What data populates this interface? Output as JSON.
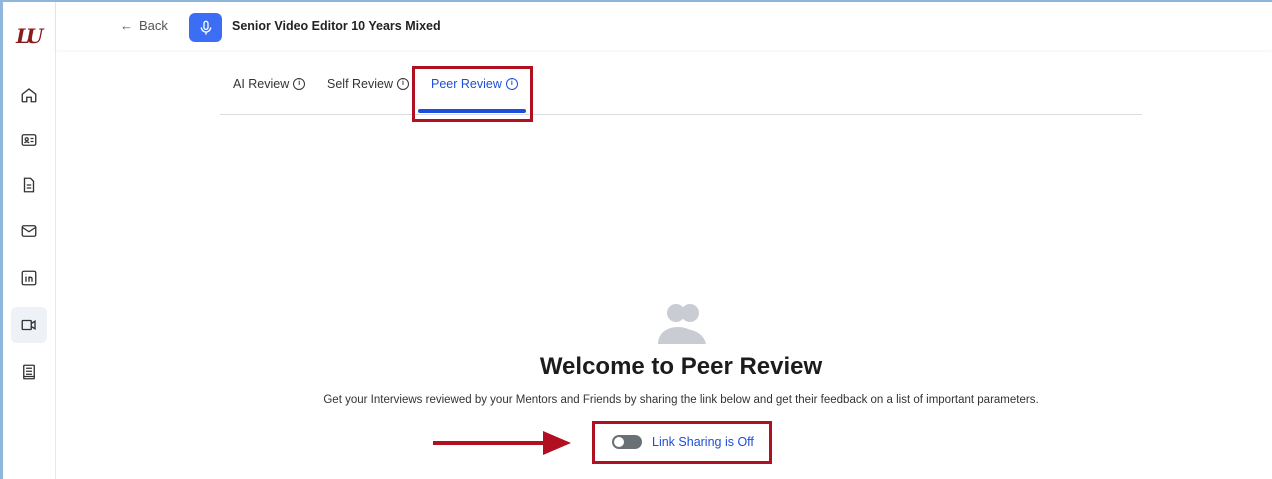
{
  "app": {
    "logo_text": "LU"
  },
  "topbar": {
    "back_label": "Back",
    "title": "Senior Video Editor 10 Years Mixed"
  },
  "sidebar": {
    "items": [
      {
        "icon": "home-icon",
        "active": false
      },
      {
        "icon": "id-card-icon",
        "active": false
      },
      {
        "icon": "document-icon",
        "active": false
      },
      {
        "icon": "mail-icon",
        "active": false
      },
      {
        "icon": "linkedin-icon",
        "active": false
      },
      {
        "icon": "video-icon",
        "active": true
      },
      {
        "icon": "notebook-icon",
        "active": false
      }
    ]
  },
  "tabs": [
    {
      "label": "AI Review",
      "active": false
    },
    {
      "label": "Self Review",
      "active": false
    },
    {
      "label": "Peer Review",
      "active": true
    }
  ],
  "main": {
    "welcome_title": "Welcome to Peer Review",
    "welcome_subtitle": "Get your Interviews reviewed by your Mentors and Friends by sharing the link below and get their feedback on a list of important parameters.",
    "link_sharing_label": "Link Sharing is Off",
    "link_sharing_enabled": false
  },
  "colors": {
    "accent": "#1d4ed8",
    "highlight": "#b0101f",
    "brand": "#8b1a1a",
    "mic_badge": "#3b6ef5"
  }
}
